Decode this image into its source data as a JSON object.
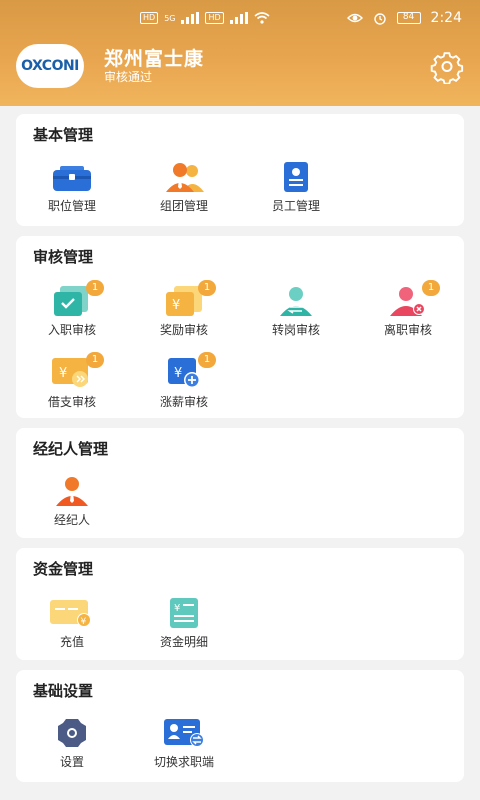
{
  "status_bar": {
    "time": "2:24",
    "network_labels": [
      "HD",
      "5G",
      "HD"
    ],
    "battery": "84"
  },
  "header": {
    "logo_text": "OXCONI",
    "company_name": "郑州富士康",
    "status": "审核通过",
    "settings_icon": "gear-icon"
  },
  "sections": {
    "basic": {
      "title": "基本管理",
      "items": [
        {
          "label": "职位管理",
          "icon": "briefcase-icon"
        },
        {
          "label": "组团管理",
          "icon": "group-icon"
        },
        {
          "label": "员工管理",
          "icon": "employee-card-icon"
        }
      ]
    },
    "review": {
      "title": "审核管理",
      "items": [
        {
          "label": "入职审核",
          "icon": "onboard-check-icon",
          "badge": "1"
        },
        {
          "label": "奖励审核",
          "icon": "reward-icon",
          "badge": "1"
        },
        {
          "label": "转岗审核",
          "icon": "transfer-user-icon",
          "badge": ""
        },
        {
          "label": "离职审核",
          "icon": "resign-user-icon",
          "badge": "1"
        },
        {
          "label": "借支审核",
          "icon": "advance-loan-icon",
          "badge": "1"
        },
        {
          "label": "涨薪审核",
          "icon": "salary-raise-icon",
          "badge": "1"
        }
      ]
    },
    "agent": {
      "title": "经纪人管理",
      "items": [
        {
          "label": "经纪人",
          "icon": "agent-user-icon"
        }
      ]
    },
    "funds": {
      "title": "资金管理",
      "items": [
        {
          "label": "充值",
          "icon": "recharge-card-icon"
        },
        {
          "label": "资金明细",
          "icon": "fund-detail-icon"
        }
      ]
    },
    "settings": {
      "title": "基础设置",
      "items": [
        {
          "label": "设置",
          "icon": "settings-gear-icon"
        },
        {
          "label": "切换求职端",
          "icon": "switch-role-icon"
        }
      ]
    }
  },
  "colors": {
    "header_orange": "#e8a54f",
    "badge_orange": "#f2a83b",
    "brand_blue": "#1b5fa8"
  }
}
